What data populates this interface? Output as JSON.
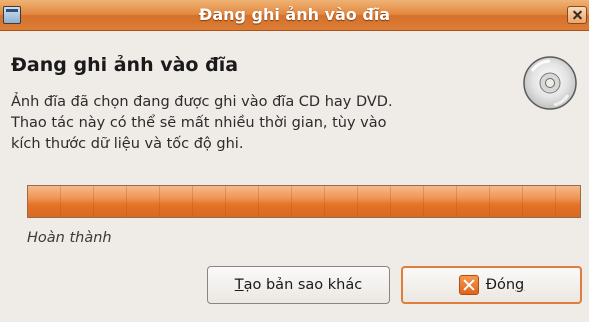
{
  "window": {
    "title": "Đang ghi ảnh vào đĩa",
    "menu_icon": "window-menu-icon",
    "close_icon": "close-icon"
  },
  "dialog": {
    "heading": "Đang ghi ảnh vào đĩa",
    "message_lines": [
      "Ảnh đĩa đã chọn đang được ghi vào đĩa CD hay DVD.",
      "Thao tác này có thể sẽ mất nhiều thời gian, tùy vào",
      "kích thước dữ liệu và tốc độ ghi."
    ],
    "icon": "cd-disc-icon"
  },
  "progress": {
    "fraction": 1.0,
    "label": "Hoàn thành"
  },
  "buttons": {
    "copy": {
      "mnemonic": "T",
      "rest": "ạo bản sao khác"
    },
    "close": {
      "pre": "Đón",
      "mnemonic": "g",
      "icon": "close-x-icon"
    }
  },
  "colors": {
    "accent": "#e07c3c",
    "titlebar": "#e3873f",
    "progress_fill": "#e57327"
  }
}
